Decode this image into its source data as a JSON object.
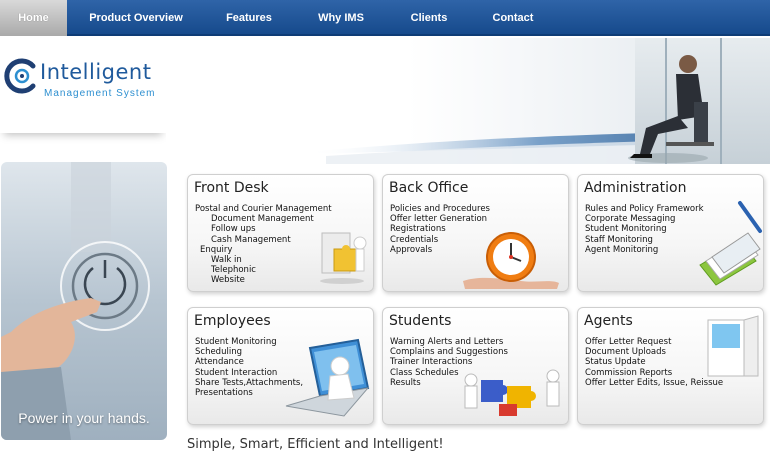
{
  "nav": {
    "items": [
      {
        "label": "Home",
        "active": true
      },
      {
        "label": "Product Overview",
        "active": false
      },
      {
        "label": "Features",
        "active": false
      },
      {
        "label": "Why IMS",
        "active": false
      },
      {
        "label": "Clients",
        "active": false
      },
      {
        "label": "Contact",
        "active": false
      }
    ]
  },
  "logo": {
    "title": "Intelligent",
    "subtitle": "Management System"
  },
  "promo": {
    "caption": "Power in your hands."
  },
  "cards": [
    {
      "title": "Front Desk",
      "items": [
        "Postal and Courier Management",
        "Document Management",
        "Follow ups",
        "Cash Management",
        "Enquiry",
        "Walk in",
        "Telephonic",
        "Website"
      ]
    },
    {
      "title": "Back Office",
      "items": [
        "Policies and Procedures",
        "Offer letter Generation",
        "Registrations",
        "Credentials",
        "Approvals"
      ]
    },
    {
      "title": "Administration",
      "items": [
        "Rules and Policy Framework",
        "Corporate Messaging",
        "Student Monitoring",
        "Staff Monitoring",
        "Agent Monitoring"
      ]
    },
    {
      "title": "Employees",
      "items": [
        "Student Monitoring",
        "Scheduling",
        "Attendance",
        "Student Interaction",
        "Share Tests,Attachments,",
        "Presentations"
      ]
    },
    {
      "title": "Students",
      "items": [
        "Warning Alerts and Letters",
        "Complains and Suggestions",
        "Trainer Interactions",
        "Class Schedules",
        "Results"
      ]
    },
    {
      "title": "Agents",
      "items": [
        "Offer Letter Request",
        "Document Uploads",
        "Status Update",
        "Commission Reports",
        "Offer Letter Edits, Issue, Reissue"
      ]
    }
  ],
  "tagline": "Simple, Smart, Efficient and Intelligent!",
  "colors": {
    "nav_blue": "#1f56a0",
    "logo_blue": "#1f5a9c",
    "logo_accent": "#2d8fd0"
  }
}
